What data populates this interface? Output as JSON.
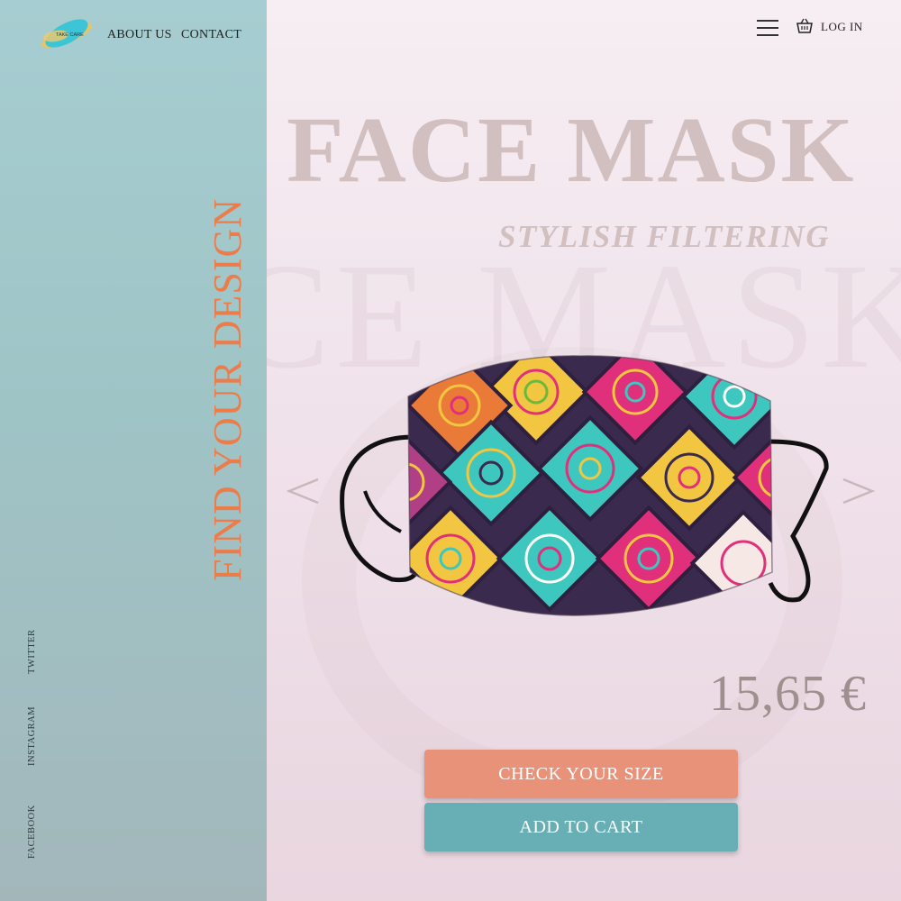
{
  "brand": {
    "logo_text": "TAKE CARE"
  },
  "nav": {
    "about": "ABOUT US",
    "contact": "CONTACT",
    "login": "LOG IN"
  },
  "headline_vertical": "FIND YOUR DESIGN",
  "social": [
    "TWITTER",
    "INSTAGRAM",
    "FACEBOOK"
  ],
  "hero": {
    "title": "FACE MASK",
    "subtitle": "STYLISH FILTERING",
    "watermark": "FACE MASK"
  },
  "product": {
    "price": "15,65 €"
  },
  "actions": {
    "check_size": "CHECK YOUR SIZE",
    "add_to_cart": "ADD TO CART"
  },
  "icons": {
    "menu": "hamburger-menu-icon",
    "cart": "basket-icon",
    "prev": "chevron-left-icon",
    "next": "chevron-right-icon"
  },
  "colors": {
    "accent_orange": "#ec7c4a",
    "button_coral": "#e8927a",
    "button_teal": "#68aeb5",
    "sidebar_teal": "#a6cdd1",
    "title_gray": "#d2c0c0"
  }
}
